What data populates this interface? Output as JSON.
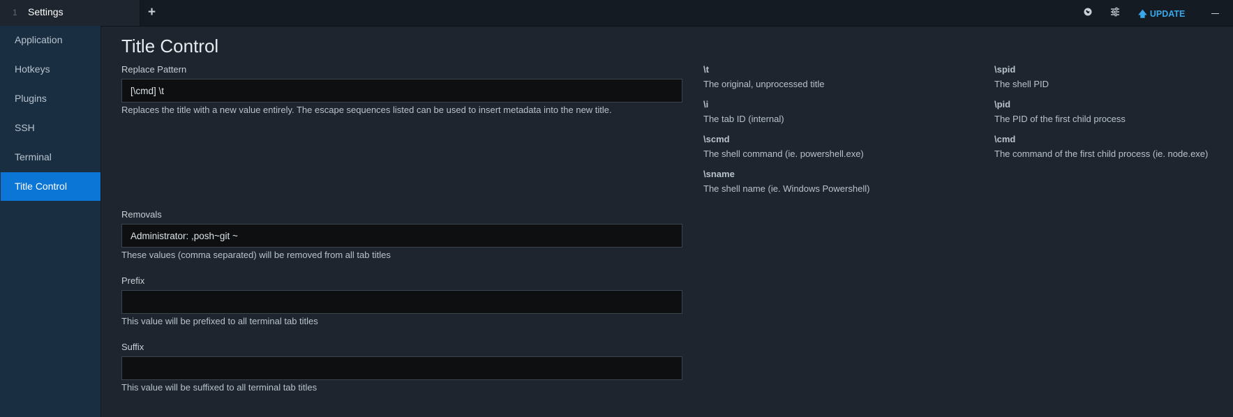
{
  "titlebar": {
    "tab_index": "1",
    "tab_title": "Settings",
    "new_tab_label": "+",
    "update_label": "UPDATE",
    "update_arrow": "🡅",
    "icons": [
      "globe-icon",
      "sliders-icon",
      "minimize-icon"
    ],
    "accent_color": "#3aa7ea"
  },
  "sidebar": {
    "items": [
      {
        "label": "Application"
      },
      {
        "label": "Hotkeys"
      },
      {
        "label": "Plugins"
      },
      {
        "label": "SSH"
      },
      {
        "label": "Terminal"
      },
      {
        "label": "Title Control",
        "active": true
      }
    ],
    "active_color": "#0c76d6"
  },
  "main": {
    "title": "Title Control",
    "replace_pattern": {
      "label": "Replace Pattern",
      "value": "[\\cmd] \\t",
      "help": "Replaces the title with a new value entirely. The escape sequences listed can be used to insert metadata into the new title."
    },
    "removals": {
      "label": "Removals",
      "value": "Administrator: ,posh~git ~",
      "help": "These values (comma separated) will be removed from all tab titles"
    },
    "prefix": {
      "label": "Prefix",
      "value": "",
      "help": "This value will be prefixed to all terminal tab titles"
    },
    "suffix": {
      "label": "Suffix",
      "value": "",
      "help": "This value will be suffixed to all terminal tab titles"
    },
    "escapes_left": [
      {
        "name": "\\t",
        "desc": "The original, unprocessed title"
      },
      {
        "name": "\\i",
        "desc": "The tab ID (internal)"
      },
      {
        "name": "\\scmd",
        "desc": "The shell command (ie. powershell.exe)"
      },
      {
        "name": "\\sname",
        "desc": "The shell name (ie. Windows Powershell)"
      }
    ],
    "escapes_right": [
      {
        "name": "\\spid",
        "desc": "The shell PID"
      },
      {
        "name": "\\pid",
        "desc": "The PID of the first child process"
      },
      {
        "name": "\\cmd",
        "desc": "The command of the first child process (ie. node.exe)"
      }
    ]
  }
}
